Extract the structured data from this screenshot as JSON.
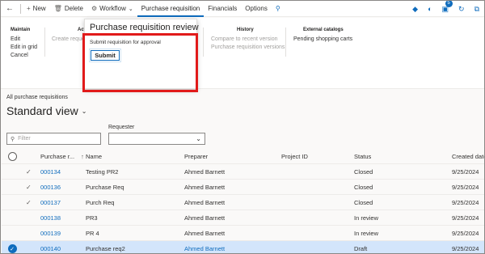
{
  "commandbar": {
    "back_icon": "back-arrow-icon",
    "new_label": "New",
    "delete_label": "Delete",
    "workflow_label": "Workflow",
    "tabs": [
      "Purchase requisition",
      "Financials",
      "Options"
    ],
    "notification_count": "5"
  },
  "ribbon": {
    "maintain": {
      "title": "Maintain",
      "items": [
        "Edit",
        "Edit in grid",
        "Cancel"
      ]
    },
    "actions_partial_title": "Act",
    "create_partial": "Create reque",
    "history": {
      "title": "History",
      "items": [
        "Compare to recent version",
        "Purchase requisition versions"
      ]
    },
    "external": {
      "title": "External catalogs",
      "items": [
        "Pending shopping carts"
      ]
    }
  },
  "popup": {
    "title": "Purchase requisition review",
    "subtitle": "Submit requisition for approval",
    "submit_label": "Submit"
  },
  "page": {
    "breadcrumb": "All purchase requisitions",
    "view_title": "Standard view",
    "filter_placeholder": "Filter",
    "requester_label": "Requester"
  },
  "grid": {
    "columns": {
      "pr": "Purchase r...",
      "name": "Name",
      "preparer": "Preparer",
      "project": "Project ID",
      "status": "Status",
      "created": "Created date"
    },
    "rows": [
      {
        "pr": "000134",
        "name": "Testing PR2",
        "preparer": "Ahmed Barnett",
        "project": "",
        "status": "Closed",
        "created": "9/25/2024",
        "checked": true,
        "selected": false
      },
      {
        "pr": "000136",
        "name": "Purchase Req",
        "preparer": "Ahmed Barnett",
        "project": "",
        "status": "Closed",
        "created": "9/25/2024",
        "checked": true,
        "selected": false
      },
      {
        "pr": "000137",
        "name": "Purch Req",
        "preparer": "Ahmed Barnett",
        "project": "",
        "status": "Closed",
        "created": "9/25/2024",
        "checked": true,
        "selected": false
      },
      {
        "pr": "000138",
        "name": "PR3",
        "preparer": "Ahmed Barnett",
        "project": "",
        "status": "In review",
        "created": "9/25/2024",
        "checked": false,
        "selected": false
      },
      {
        "pr": "000139",
        "name": "PR 4",
        "preparer": "Ahmed Barnett",
        "project": "",
        "status": "In review",
        "created": "9/25/2024",
        "checked": false,
        "selected": false
      },
      {
        "pr": "000140",
        "name": "Purchase req2",
        "preparer": "Ahmed Barnett",
        "project": "",
        "status": "Draft",
        "created": "9/25/2024",
        "checked": false,
        "selected": true
      }
    ]
  },
  "colors": {
    "accent": "#0f6cbd",
    "highlight_box": "#e11a1a",
    "selected_row": "#d3e5fb"
  }
}
